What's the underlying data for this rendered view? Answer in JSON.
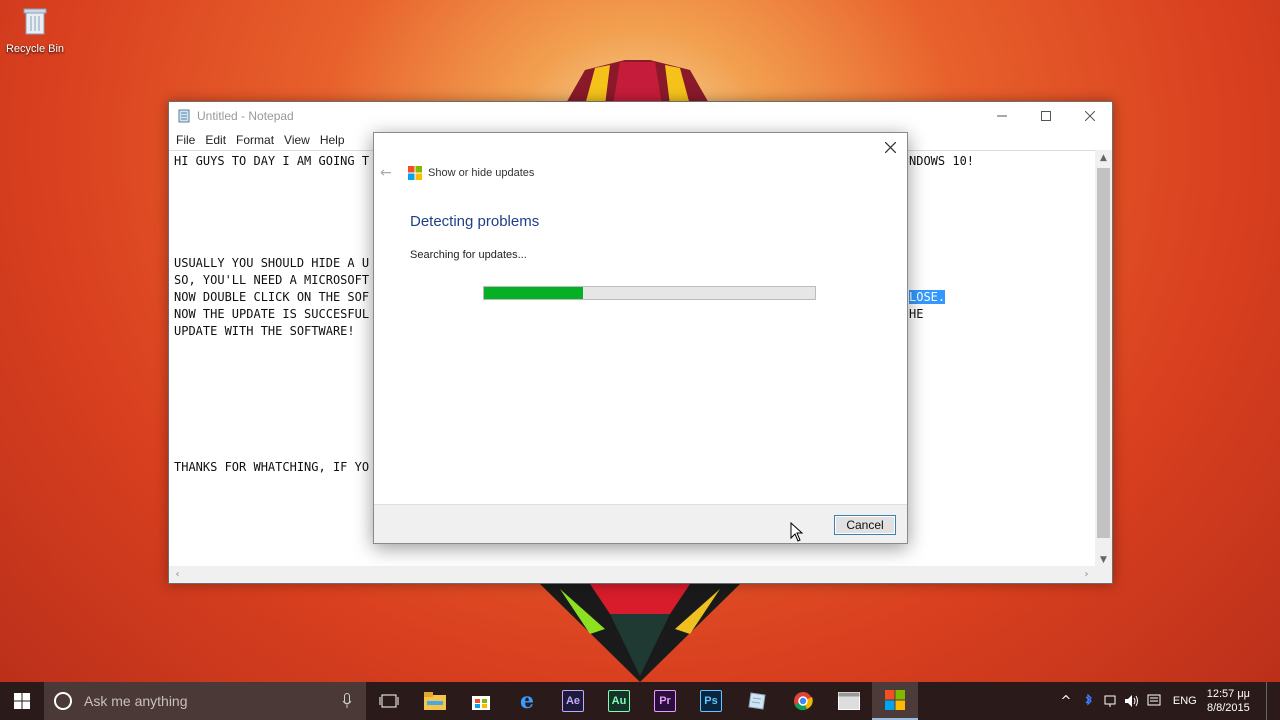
{
  "desktop": {
    "recycle_bin_label": "Recycle Bin"
  },
  "notepad": {
    "title": "Untitled - Notepad",
    "menu": [
      "File",
      "Edit",
      "Format",
      "View",
      "Help"
    ],
    "lines": [
      {
        "left": "HI GUYS TO DAY I AM GOING T",
        "right": "NDOWS 10!"
      },
      {
        "left": "",
        "right": ""
      },
      {
        "left": "",
        "right": ""
      },
      {
        "left": "",
        "right": ""
      },
      {
        "left": "",
        "right": ""
      },
      {
        "left": "",
        "right": ""
      },
      {
        "left": "USUALLY YOU SHOULD HIDE A U",
        "right": ""
      },
      {
        "left": "SO, YOU'LL NEED A MICROSOFT",
        "right": ""
      },
      {
        "left": "NOW DOUBLE CLICK ON THE SOF",
        "right": "LOSE."
      },
      {
        "left": "NOW THE UPDATE IS SUCCESFUL",
        "right": "HE"
      },
      {
        "left": "UPDATE WITH THE SOFTWARE!",
        "right": ""
      },
      {
        "left": "",
        "right": ""
      },
      {
        "left": "",
        "right": ""
      },
      {
        "left": "",
        "right": ""
      },
      {
        "left": "",
        "right": ""
      },
      {
        "left": "",
        "right": ""
      },
      {
        "left": "",
        "right": ""
      },
      {
        "left": "",
        "right": ""
      },
      {
        "left": "THANKS FOR WHATCHING, IF YO",
        "right": ""
      }
    ]
  },
  "dialog": {
    "title": "Show or hide updates",
    "heading": "Detecting problems",
    "status": "Searching for updates...",
    "progress": 0.3,
    "cancel_label": "Cancel"
  },
  "taskbar": {
    "search_placeholder": "Ask me anything",
    "apps": [
      {
        "name": "task-view",
        "label": ""
      },
      {
        "name": "file-explorer",
        "label": ""
      },
      {
        "name": "store",
        "label": ""
      },
      {
        "name": "edge",
        "label": "e"
      },
      {
        "name": "after-effects",
        "label": "Ae",
        "color": "#1d1b3a",
        "fg": "#c8a8ff"
      },
      {
        "name": "audition",
        "label": "Au",
        "color": "#16322a",
        "fg": "#7dffb0"
      },
      {
        "name": "premiere",
        "label": "Pr",
        "color": "#2a0f3c",
        "fg": "#e79bff"
      },
      {
        "name": "photoshop",
        "label": "Ps",
        "color": "#0b2540",
        "fg": "#5fc7ff"
      },
      {
        "name": "notepad",
        "label": ""
      },
      {
        "name": "chrome",
        "label": ""
      },
      {
        "name": "show-hide-updates",
        "label": ""
      }
    ],
    "tray": {
      "language": "ENG",
      "time": "12:57 μμ",
      "date": "8/8/2015"
    }
  }
}
